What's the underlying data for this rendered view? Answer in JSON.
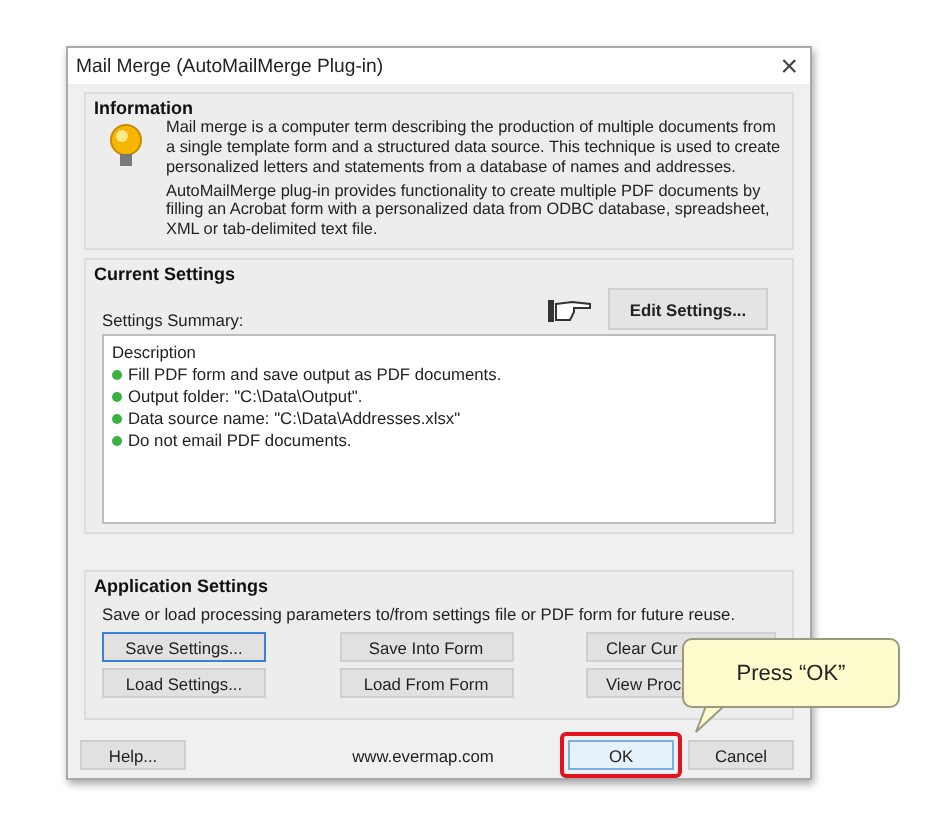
{
  "window": {
    "title": "Mail Merge (AutoMailMerge Plug-in)",
    "close": "×"
  },
  "information": {
    "title": "Information",
    "paragraphs": [
      "Mail merge is a computer term describing the production of multiple documents from a single template form and a structured data source. This technique is used to create personalized letters and statements from a database of names and addresses.",
      "AutoMailMerge plug-in provides functionality to create multiple PDF documents by filling an Acrobat form with a personalized data from ODBC database, spreadsheet, XML or tab-delimited text file."
    ]
  },
  "current_settings": {
    "title": "Current Settings",
    "summary_label": "Settings Summary:",
    "edit_button": "Edit Settings...",
    "summary": {
      "heading": "Description",
      "items": [
        {
          "text": "Fill PDF form and save output as PDF documents.",
          "color": "#3cb043"
        },
        {
          "text": "Output folder: \"C:\\Data\\Output\".",
          "color": "#3cb043"
        },
        {
          "text": "Data source name: \"C:\\Data\\Addresses.xlsx\"",
          "color": "#3cb043"
        },
        {
          "text": "Do not email PDF documents.",
          "color": "#3cb043"
        }
      ]
    }
  },
  "application_settings": {
    "title": "Application Settings",
    "description": "Save or load processing parameters to/from settings file or PDF form for future reuse.",
    "buttons": [
      {
        "label": "Save Settings...",
        "focused": true
      },
      {
        "label": "Save Into Form",
        "focused": false
      },
      {
        "label": "Clear Cur",
        "focused": false
      },
      {
        "label": "Load Settings...",
        "focused": false
      },
      {
        "label": "Load From Form",
        "focused": false
      },
      {
        "label": "View Proc",
        "focused": false
      }
    ]
  },
  "footer": {
    "help": "Help...",
    "link": "www.evermap.com",
    "buttons": [
      {
        "label": "OK",
        "highlighted": true
      },
      {
        "label": "Cancel",
        "highlighted": false
      }
    ]
  },
  "callout": {
    "text": "Press “OK”"
  }
}
